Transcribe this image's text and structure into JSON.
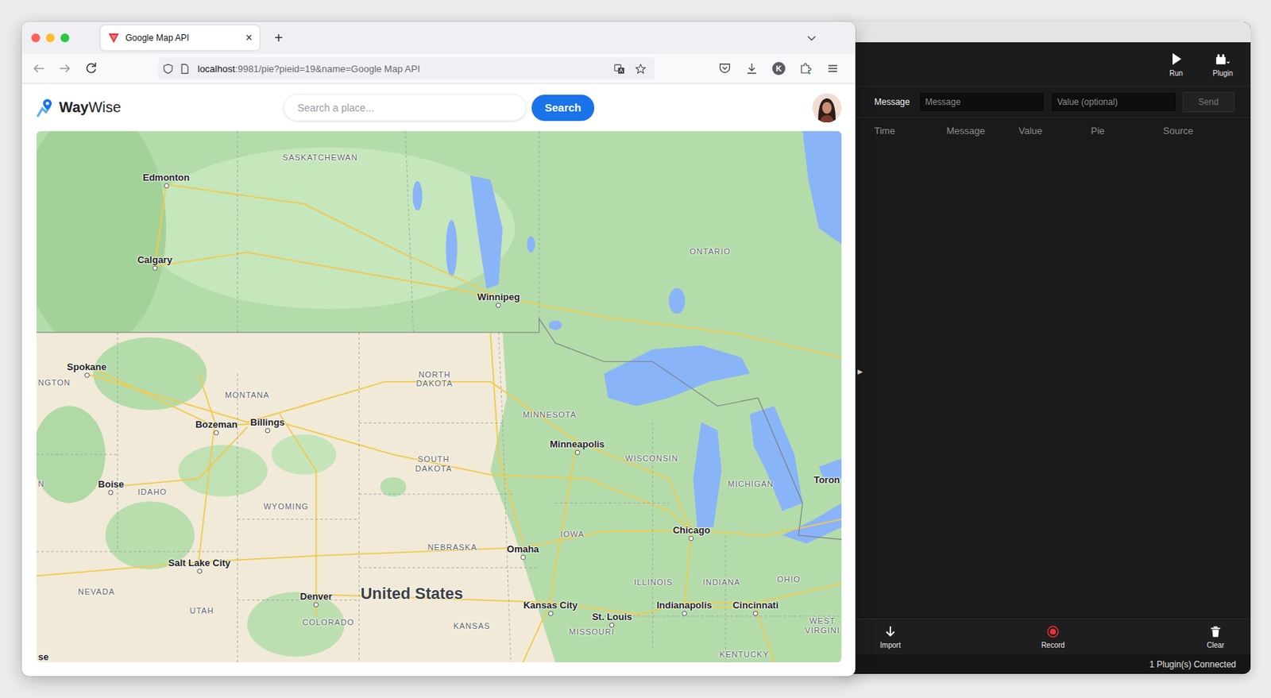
{
  "browser": {
    "tab_title": "Google Map API",
    "tab_close": "×",
    "new_tab": "+",
    "url_host": "localhost",
    "url_rest": ":9981/pie?pieid=19&name=Google Map API",
    "profile_initial": "K"
  },
  "app": {
    "logo_bold": "Way",
    "logo_rest": "Wise",
    "search_placeholder": "Search a place...",
    "search_button": "Search"
  },
  "map": {
    "labels": [
      {
        "text": "SASKATCHEWAN",
        "kind": "state"
      },
      {
        "text": "Edmonton",
        "kind": "city"
      },
      {
        "text": "Calgary",
        "kind": "city"
      },
      {
        "text": "Winnipeg",
        "kind": "city"
      },
      {
        "text": "ONTARIO",
        "kind": "state"
      },
      {
        "text": "Spokane",
        "kind": "city"
      },
      {
        "text": "NGTON",
        "kind": "state"
      },
      {
        "text": "MONTANA",
        "kind": "state"
      },
      {
        "text": "NORTH DAKOTA",
        "kind": "state"
      },
      {
        "text": "MINNESOTA",
        "kind": "state"
      },
      {
        "text": "Bozeman",
        "kind": "city"
      },
      {
        "text": "Billings",
        "kind": "city"
      },
      {
        "text": "SOUTH DAKOTA",
        "kind": "state"
      },
      {
        "text": "Minneapolis",
        "kind": "city"
      },
      {
        "text": "WISCONSIN",
        "kind": "state"
      },
      {
        "text": "MICHIGAN",
        "kind": "state"
      },
      {
        "text": "Toron",
        "kind": "place"
      },
      {
        "text": "N",
        "kind": "state"
      },
      {
        "text": "Boise",
        "kind": "city"
      },
      {
        "text": "IDAHO",
        "kind": "state"
      },
      {
        "text": "WYOMING",
        "kind": "state"
      },
      {
        "text": "IOWA",
        "kind": "state"
      },
      {
        "text": "Chicago",
        "kind": "city"
      },
      {
        "text": "NEBRASKA",
        "kind": "state"
      },
      {
        "text": "Omaha",
        "kind": "city"
      },
      {
        "text": "Salt Lake City",
        "kind": "city"
      },
      {
        "text": "NEVADA",
        "kind": "state"
      },
      {
        "text": "UTAH",
        "kind": "state"
      },
      {
        "text": "Denver",
        "kind": "city"
      },
      {
        "text": "United States",
        "kind": "country"
      },
      {
        "text": "COLORADO",
        "kind": "state"
      },
      {
        "text": "Kansas City",
        "kind": "city"
      },
      {
        "text": "St. Louis",
        "kind": "city"
      },
      {
        "text": "ILLINOIS",
        "kind": "state"
      },
      {
        "text": "INDIANA",
        "kind": "state"
      },
      {
        "text": "OHIO",
        "kind": "state"
      },
      {
        "text": "Indianapolis",
        "kind": "city"
      },
      {
        "text": "Cincinnati",
        "kind": "city"
      },
      {
        "text": "WEST VIRGINI",
        "kind": "state"
      },
      {
        "text": "KANSAS",
        "kind": "state"
      },
      {
        "text": "MISSOURI",
        "kind": "state"
      },
      {
        "text": "KENTUCKY",
        "kind": "state"
      },
      {
        "text": "se",
        "kind": "place"
      }
    ]
  },
  "panel": {
    "toolbar": [
      {
        "label": "Run"
      },
      {
        "label": "Plugin"
      }
    ],
    "message_label": "Message",
    "message_placeholder": "Message",
    "value_placeholder": "Value (optional)",
    "send": {
      "label": "Send",
      "disabled": true
    },
    "columns": [
      "Time",
      "Message",
      "Value",
      "Pie",
      "Source"
    ],
    "toggle": "▶",
    "bottom": [
      {
        "label": "Import"
      },
      {
        "label": "Record"
      },
      {
        "label": "Clear"
      }
    ],
    "status": "1 Plugin(s) Connected"
  }
}
